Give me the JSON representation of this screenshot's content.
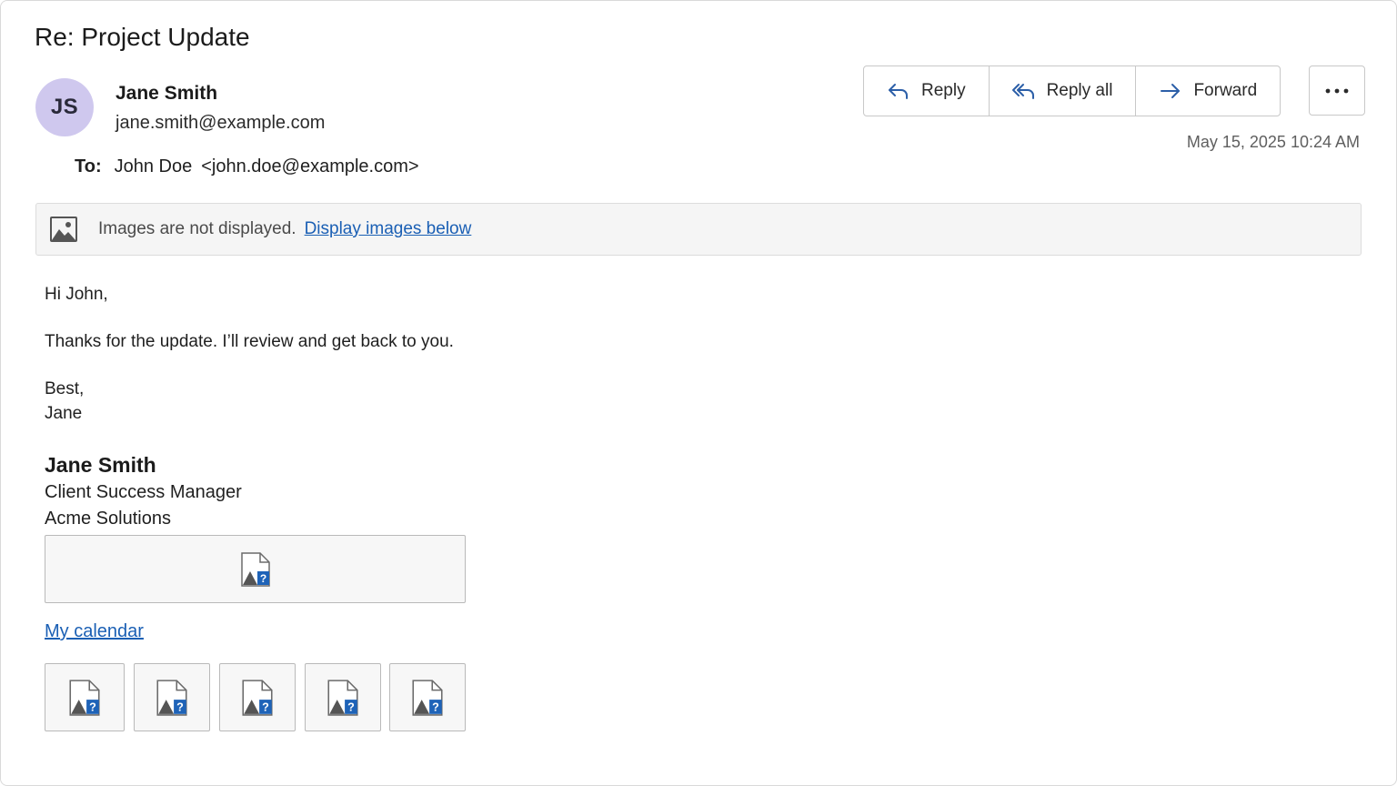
{
  "email": {
    "subject": "Re: Project Update",
    "sender": {
      "initials": "JS",
      "name": "Jane Smith",
      "email": "jane.smith@example.com"
    },
    "recipients": {
      "label": "To:",
      "name": "John Doe",
      "address": "<john.doe@example.com>"
    },
    "timestamp": "May 15, 2025 10:24 AM"
  },
  "actions": {
    "reply": "Reply",
    "reply_all": "Reply all",
    "forward": "Forward"
  },
  "image_banner": {
    "message": "Images are not displayed.",
    "link": "Display images below"
  },
  "body": {
    "greeting": "Hi John,",
    "paragraph": "Thanks for the update. I’ll review and get back to you.",
    "closing": "Best,",
    "closing_name": "Jane"
  },
  "signature": {
    "name": "Jane Smith",
    "title": "Client Success Manager",
    "company": "Acme Solutions",
    "calendar_link": "My calendar"
  },
  "colors": {
    "avatar_bg": "#cfc8ee",
    "link": "#1a5fb4",
    "icon_blue": "#1e63b8"
  }
}
